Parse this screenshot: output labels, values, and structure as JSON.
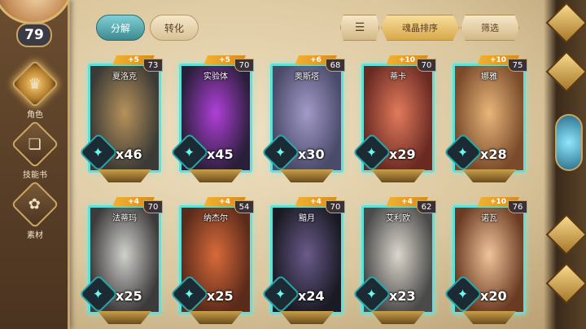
{
  "player": {
    "level": "79"
  },
  "sidebar": {
    "items": [
      {
        "label": "角色",
        "icon": "helmet-icon",
        "active": true
      },
      {
        "label": "技能书",
        "icon": "book-icon",
        "active": false
      },
      {
        "label": "素材",
        "icon": "material-icon",
        "active": false
      }
    ]
  },
  "tabs": [
    {
      "label": "分解",
      "active": true
    },
    {
      "label": "转化",
      "active": false
    }
  ],
  "toolbar": {
    "sort_icon": "sort-list-icon",
    "sort_label": "魂晶排序",
    "filter_label": "筛选"
  },
  "cards": [
    {
      "name": "夏洛克",
      "plus": "+5",
      "level": "73",
      "count": "x46",
      "art_colors": [
        "#3b3a36",
        "#b7925a"
      ]
    },
    {
      "name": "实验体",
      "plus": "+5",
      "level": "70",
      "count": "x45",
      "art_colors": [
        "#2a1f3a",
        "#b03fd8"
      ]
    },
    {
      "name": "奥斯塔",
      "plus": "+6",
      "level": "68",
      "count": "x30",
      "art_colors": [
        "#4a4a6a",
        "#a39ac8"
      ]
    },
    {
      "name": "蒂卡",
      "plus": "+10",
      "level": "70",
      "count": "x29",
      "art_colors": [
        "#6a2a22",
        "#e27a5c"
      ]
    },
    {
      "name": "娜雅",
      "plus": "+10",
      "level": "75",
      "count": "x28",
      "art_colors": [
        "#7a4a2a",
        "#e8b67a"
      ]
    },
    {
      "name": "法蒂玛",
      "plus": "+4",
      "level": "70",
      "count": "x25",
      "art_colors": [
        "#3c3a3a",
        "#d0d0cc"
      ]
    },
    {
      "name": "纳杰尔",
      "plus": "+4",
      "level": "54",
      "count": "x25",
      "art_colors": [
        "#5a2a1a",
        "#d86a3a"
      ]
    },
    {
      "name": "黯月",
      "plus": "+4",
      "level": "70",
      "count": "x24",
      "art_colors": [
        "#1a1a24",
        "#6a5a8a"
      ]
    },
    {
      "name": "艾利欧",
      "plus": "+4",
      "level": "62",
      "count": "x23",
      "art_colors": [
        "#4a4a4a",
        "#dcd6cc"
      ]
    },
    {
      "name": "诺瓦",
      "plus": "+10",
      "level": "76",
      "count": "x20",
      "art_colors": [
        "#6a3a22",
        "#f0c49a"
      ]
    }
  ]
}
